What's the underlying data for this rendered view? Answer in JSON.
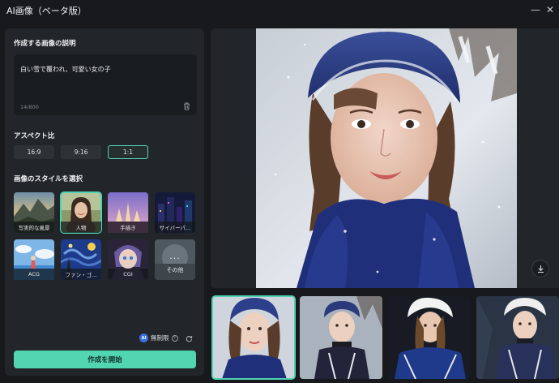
{
  "window": {
    "title": "AI画像（ベータ版）",
    "minimize_glyph": "—",
    "close_glyph": "✕"
  },
  "prompt": {
    "heading": "作成する画像の説明",
    "value": "白い雪で覆われ、可愛い女の子",
    "char_count": "14/800",
    "clear_icon": "trash-icon"
  },
  "aspect": {
    "heading": "アスペクト比",
    "options": [
      "16:9",
      "9:16",
      "1:1"
    ],
    "selected": "1:1"
  },
  "styles": {
    "heading": "画像のスタイルを選択",
    "items": [
      {
        "label": "写実的な風景"
      },
      {
        "label": "人物"
      },
      {
        "label": "手描き"
      },
      {
        "label": "サイバーパ..."
      },
      {
        "label": "ACG"
      },
      {
        "label": "ファン・ゴ..."
      },
      {
        "label": "CGI"
      },
      {
        "label": "その他"
      }
    ],
    "selected": "人物",
    "more_glyph": "···"
  },
  "quota": {
    "badge": "AI",
    "label": "無制限",
    "help_glyph": "?"
  },
  "generate": {
    "label": "作成を開始"
  },
  "colors": {
    "accent": "#4fd3b4",
    "panel": "#22262a",
    "background": "#17191c"
  },
  "results": {
    "thumbnail_count": 4,
    "selected_index": 0
  }
}
